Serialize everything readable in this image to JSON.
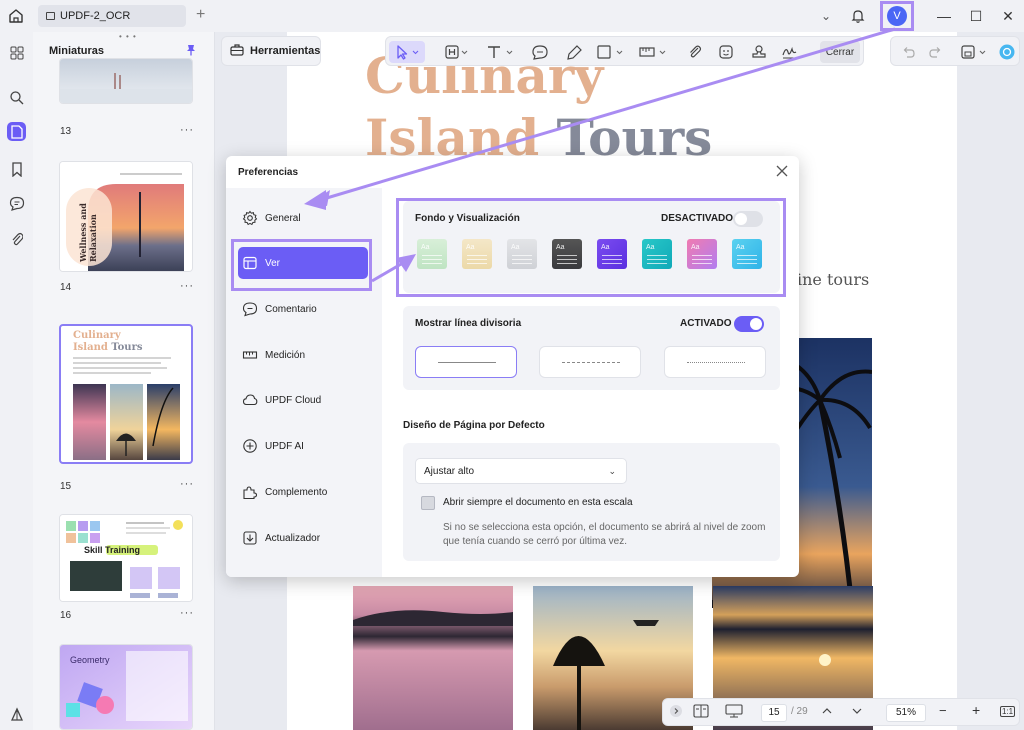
{
  "window": {
    "tab_title": "UPDF-2_OCR",
    "add_tab": "+",
    "avatar_letter": "V"
  },
  "colors": {
    "accent": "#6b5df5",
    "highlight": "#a98cf2",
    "title_peach": "#e3b08f",
    "title_grey": "#858a99"
  },
  "thumbnails": {
    "title": "Miniaturas",
    "pages": [
      {
        "number": "13",
        "more": "···"
      },
      {
        "number": "14",
        "more": "···"
      },
      {
        "number": "15",
        "more": "···"
      },
      {
        "number": "16",
        "more": "···"
      },
      {
        "number": "",
        "more": ""
      }
    ],
    "page14_text": "Wellness and Relaxation",
    "page15_title_a": "Culinary",
    "page15_title_b1": "Island",
    "page15_title_b2": "Tours",
    "page16_text": "Skill Training",
    "page17_text": "Geometry"
  },
  "toolbar": {
    "tools_label": "Herramientas",
    "close_label": "Cerrar"
  },
  "document": {
    "title_line1": "Culinary",
    "title_line2_a": "Island",
    "title_line2_b": "Tours",
    "side_text": "ine tours"
  },
  "preferences": {
    "title": "Preferencias",
    "nav": [
      {
        "label": "General",
        "icon": "gear-icon"
      },
      {
        "label": "Ver",
        "icon": "view-icon"
      },
      {
        "label": "Comentario",
        "icon": "comment-icon"
      },
      {
        "label": "Medición",
        "icon": "ruler-icon"
      },
      {
        "label": "UPDF Cloud",
        "icon": "cloud-icon"
      },
      {
        "label": "UPDF AI",
        "icon": "ai-icon"
      },
      {
        "label": "Complemento",
        "icon": "plugin-icon"
      },
      {
        "label": "Actualizador",
        "icon": "update-icon"
      }
    ],
    "background_section": {
      "title": "Fondo y Visualización",
      "toggle_label": "DESACTIVADO",
      "toggle_on": false,
      "swatch_label": "Aa"
    },
    "divider_section": {
      "title": "Mostrar línea divisoria",
      "toggle_label": "ACTIVADO",
      "toggle_on": true,
      "options": [
        "solid",
        "dashed",
        "dotted"
      ],
      "selected": "solid"
    },
    "layout_section": {
      "title": "Diseño de Página por Defecto",
      "select_value": "Ajustar alto",
      "checkbox_label": "Abrir siempre el documento en esta escala",
      "checkbox_checked": false,
      "note": "Si no se selecciona esta opción, el documento se abrirá al nivel de zoom que tenía cuando se cerró por última vez."
    }
  },
  "status": {
    "page_current": "15",
    "page_total": "/ 29",
    "zoom": "51%",
    "zoom_out": "−",
    "zoom_in": "+",
    "fit": "1:1"
  }
}
